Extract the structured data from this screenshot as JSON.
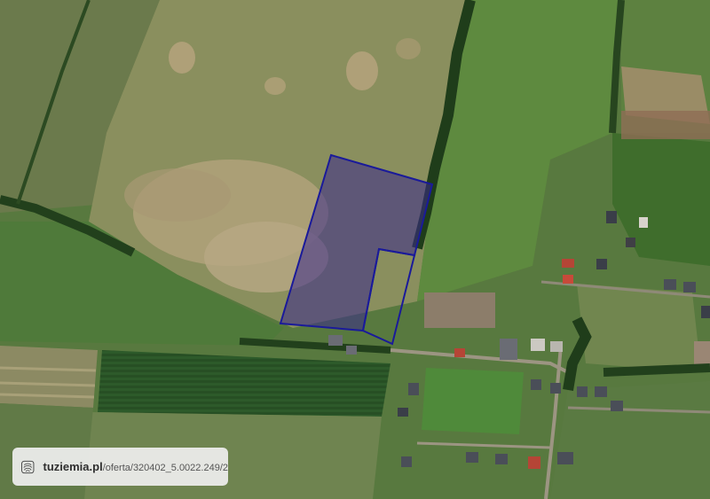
{
  "map": {
    "type": "satellite-aerial",
    "parcel_outline_color": "#1a1a9a",
    "parcel_fill_color": "#3a2a8c"
  },
  "watermark": {
    "icon": "fingerprint-icon",
    "domain": "tuziemia.pl",
    "path": "/oferta/320402_5.0022.249/2"
  }
}
